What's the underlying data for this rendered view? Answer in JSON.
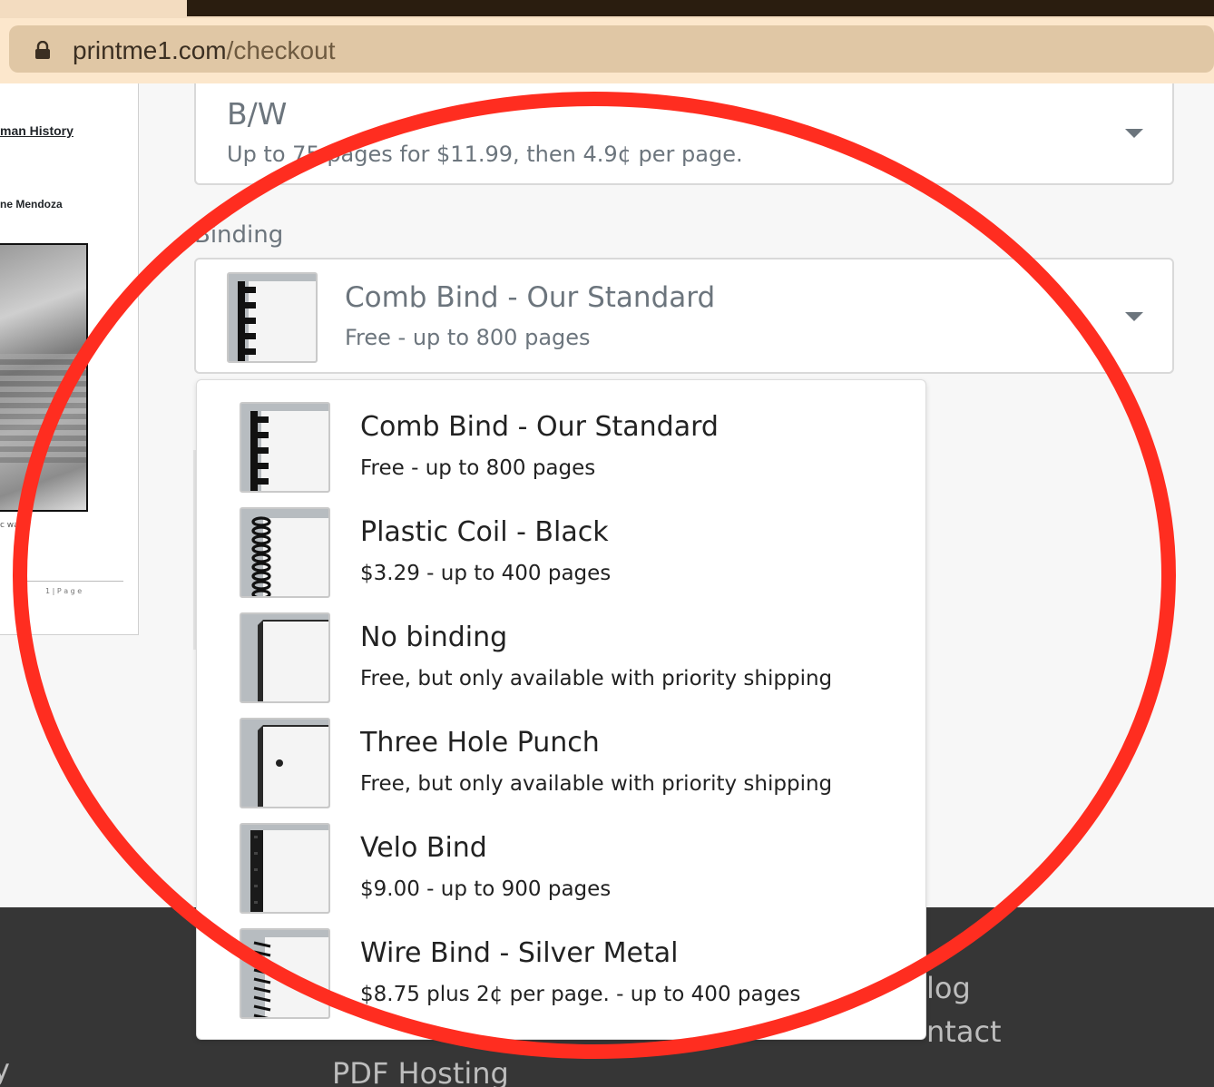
{
  "browser": {
    "url_host": "printme1.com",
    "url_path": "/checkout"
  },
  "preview": {
    "title": "man History",
    "author": "ne Mendoza",
    "caption": "c wal",
    "page_num": "1 | P a g e"
  },
  "color_select": {
    "value": "B/W",
    "description": "Up to 75 pages for $11.99, then 4.9¢ per page."
  },
  "binding": {
    "label": "Binding",
    "selected": {
      "name": "Comb Bind - Our Standard",
      "sub": "Free - up to 800 pages",
      "icon": "comb-bind-icon"
    },
    "options": [
      {
        "name": "Comb Bind - Our Standard",
        "sub": "Free - up to 800 pages",
        "icon": "comb-bind-icon"
      },
      {
        "name": "Plastic Coil - Black",
        "sub": "$3.29 - up to 400 pages",
        "icon": "plastic-coil-icon"
      },
      {
        "name": "No binding",
        "sub": "Free, but only available with priority shipping",
        "icon": "no-binding-icon"
      },
      {
        "name": "Three Hole Punch",
        "sub": "Free, but only available with priority shipping",
        "icon": "three-hole-punch-icon"
      },
      {
        "name": "Velo Bind",
        "sub": "$9.00 - up to 900 pages",
        "icon": "velo-bind-icon"
      },
      {
        "name": "Wire Bind - Silver Metal",
        "sub": "$8.75 plus 2¢ per page. - up to 400 pages",
        "icon": "wire-bind-icon"
      }
    ]
  },
  "footer": {
    "links": [
      "y",
      "PDF Hosting",
      "log",
      "ntact"
    ]
  },
  "colors": {
    "annotation": "#ff2d20",
    "footer_bg": "#363636",
    "muted_text": "#6c757d"
  }
}
